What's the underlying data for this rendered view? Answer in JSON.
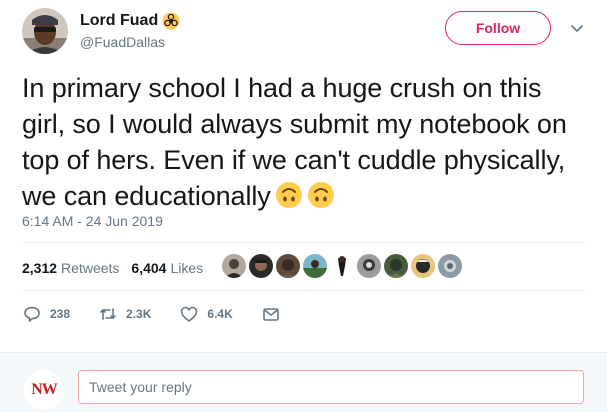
{
  "author": {
    "display_name": "Lord Fuad",
    "handle": "@FuadDallas",
    "badge_icon": "biohazard-icon"
  },
  "follow_label": "Follow",
  "tweet_text": "In primary school I had a huge crush on this girl, so I would always submit my notebook on top of hers. Even if we can't cuddle physically, we can educationally",
  "emojis": [
    "upside-down-face-icon",
    "upside-down-face-icon"
  ],
  "timestamp": "6:14 AM - 24 Jun 2019",
  "stats": {
    "retweets_count": "2,312",
    "retweets_label": "Retweets",
    "likes_count": "6,404",
    "likes_label": "Likes"
  },
  "actions": {
    "reply_count": "238",
    "retweet_count": "2.3K",
    "like_count": "6.4K"
  },
  "reply": {
    "avatar_text": "NW",
    "placeholder": "Tweet your reply"
  },
  "colors": {
    "accent": "#e0245e",
    "secondary_text": "#657786",
    "divider": "#e6ecf0"
  }
}
